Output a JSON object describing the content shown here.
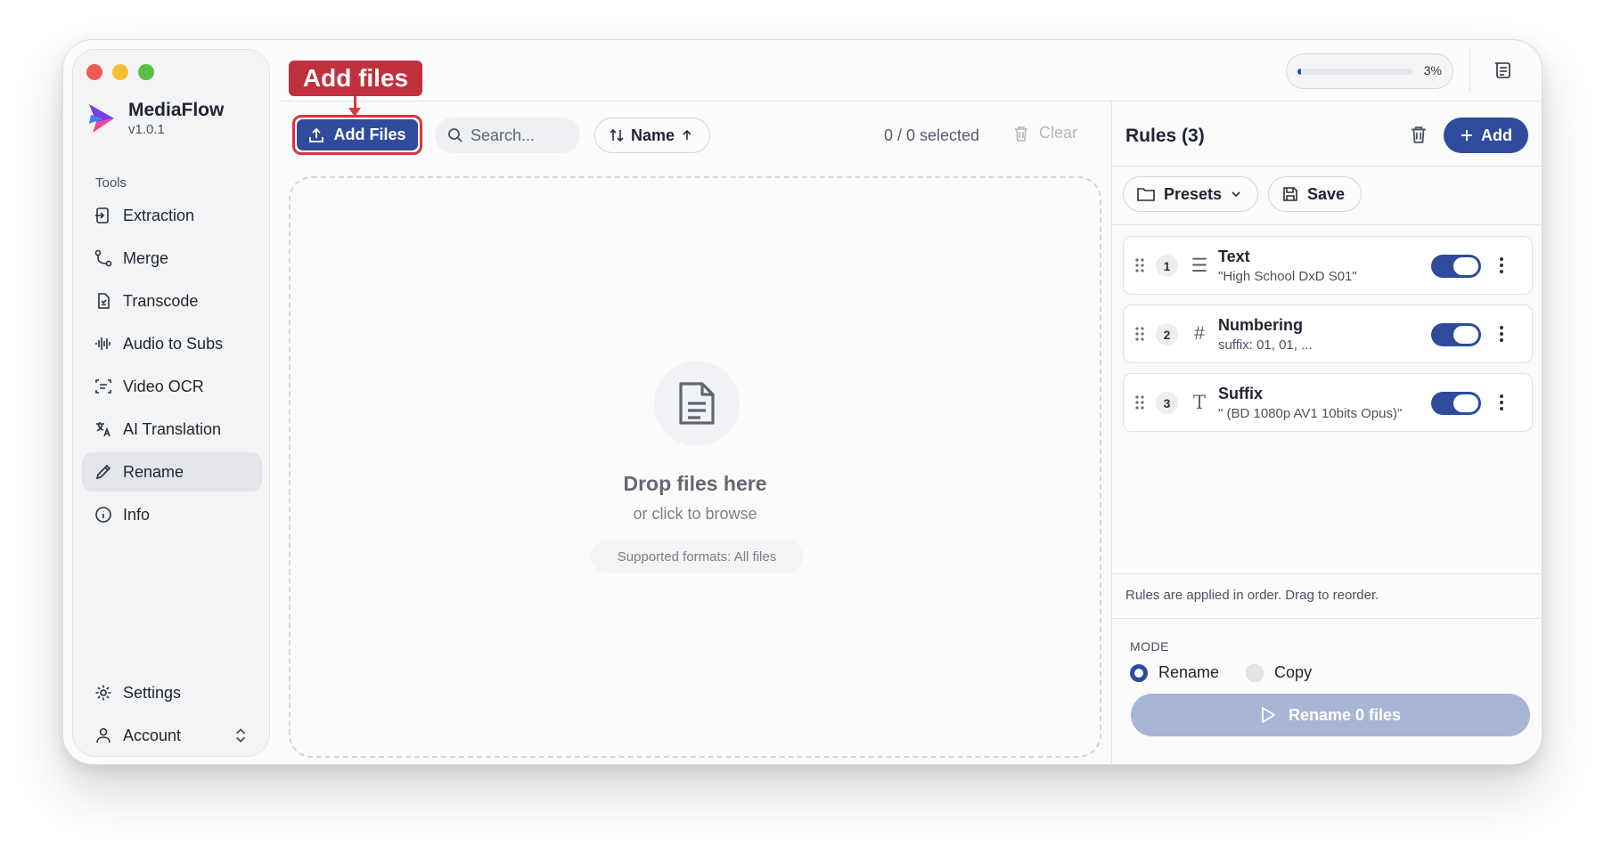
{
  "app": {
    "name": "MediaFlow",
    "version": "v1.0.1"
  },
  "sidebar": {
    "section_label": "Tools",
    "items": [
      {
        "label": "Extraction",
        "icon": "extraction-icon"
      },
      {
        "label": "Merge",
        "icon": "merge-icon"
      },
      {
        "label": "Transcode",
        "icon": "transcode-icon"
      },
      {
        "label": "Audio to Subs",
        "icon": "audio-wave-icon"
      },
      {
        "label": "Video OCR",
        "icon": "ocr-scan-icon"
      },
      {
        "label": "AI Translation",
        "icon": "translate-icon"
      },
      {
        "label": "Rename",
        "icon": "pencil-icon",
        "active": true
      },
      {
        "label": "Info",
        "icon": "info-icon"
      }
    ],
    "bottom": {
      "settings_label": "Settings",
      "account_label": "Account"
    }
  },
  "topbar": {
    "progress_percent": 3,
    "progress_text": "3%"
  },
  "annotation": {
    "label": "Add files"
  },
  "toolbar": {
    "add_files_label": "Add Files",
    "search_placeholder": "Search...",
    "sort_label": "Name",
    "selection_text": "0 / 0 selected",
    "clear_label": "Clear"
  },
  "dropzone": {
    "title": "Drop files here",
    "subtitle": "or click to browse",
    "formats": "Supported formats: All files"
  },
  "rules_panel": {
    "title": "Rules (3)",
    "add_label": "Add",
    "presets_label": "Presets",
    "save_label": "Save",
    "rules": [
      {
        "num": "1",
        "icon_glyph": "☰",
        "name": "Text",
        "desc": "\"High School DxD S01\"",
        "enabled": true
      },
      {
        "num": "2",
        "icon_glyph": "#",
        "name": "Numbering",
        "desc": "suffix: 01, 01, ...",
        "enabled": true
      },
      {
        "num": "3",
        "icon_glyph": "T",
        "name": "Suffix",
        "desc": "\" (BD 1080p AV1 10bits Opus)\"",
        "enabled": true
      }
    ],
    "note": "Rules are applied in order. Drag to reorder.",
    "mode_label": "MODE",
    "mode_options": [
      "Rename",
      "Copy"
    ],
    "selected_mode": "Rename",
    "run_label": "Rename 0 files"
  },
  "colors": {
    "accent": "#2f4b9c",
    "annotation": "#c0303d",
    "run_disabled": "#a9b5d4"
  }
}
